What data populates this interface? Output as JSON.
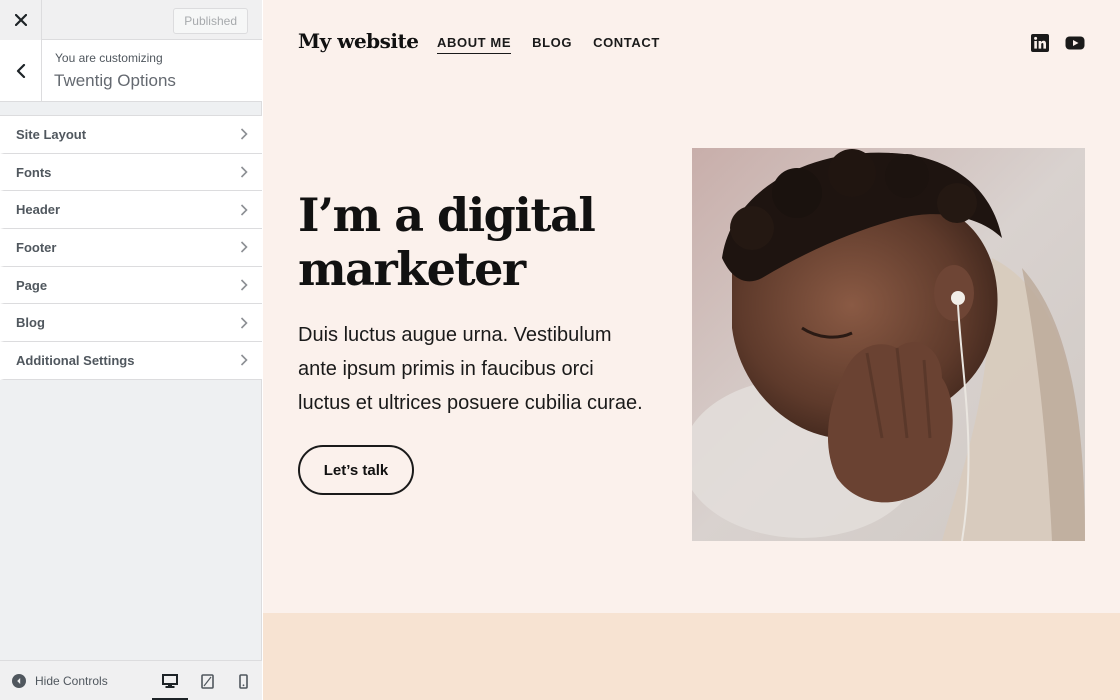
{
  "customizer": {
    "publish_label": "Published",
    "crumb_subtitle": "You are customizing",
    "crumb_title": "Twentig Options",
    "menu": [
      {
        "label": "Site Layout"
      },
      {
        "label": "Fonts"
      },
      {
        "label": "Header"
      },
      {
        "label": "Footer"
      },
      {
        "label": "Page"
      },
      {
        "label": "Blog"
      },
      {
        "label": "Additional Settings"
      }
    ],
    "hide_controls_label": "Hide Controls",
    "devices": [
      "desktop-icon",
      "tablet-icon",
      "mobile-icon"
    ],
    "active_device": "desktop"
  },
  "site": {
    "title": "My website",
    "nav": [
      {
        "label": "ABOUT ME",
        "current": true
      },
      {
        "label": "BLOG",
        "current": false
      },
      {
        "label": "CONTACT",
        "current": false
      }
    ],
    "social": [
      "linkedin-icon",
      "youtube-icon"
    ]
  },
  "hero": {
    "title_line1": "I’m a digital",
    "title_line2": "marketer",
    "text_line1": "Duis luctus augue urna. Vestibulum",
    "text_line2": "ante ipsum primis in faucibus orci",
    "text_line3": "luctus et ultrices posuere cubilia curae.",
    "cta_label": "Let’s talk"
  },
  "colors": {
    "preview_bg": "#fbf1ec",
    "band_bg": "#f7e3d2",
    "sidebar_bg": "#eef0f2",
    "text_dark": "#111111"
  }
}
